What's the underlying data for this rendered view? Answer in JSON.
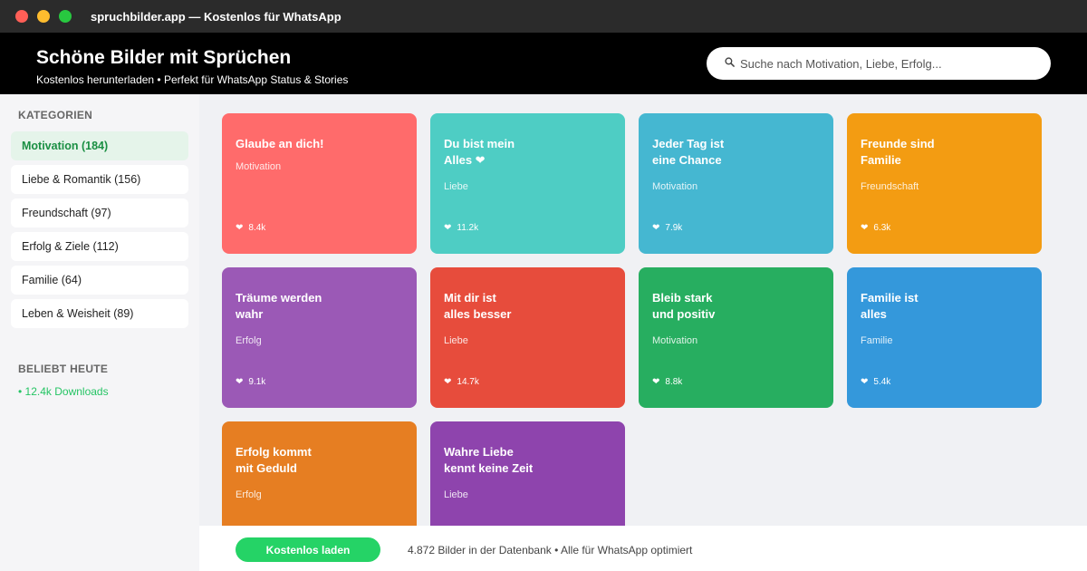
{
  "window": {
    "title": "spruchbilder.app — Kostenlos für WhatsApp"
  },
  "header": {
    "title": "Schöne Bilder mit Sprüchen",
    "subtitle": "Kostenlos herunterladen • Perfekt für WhatsApp Status & Stories",
    "search_placeholder": "Suche nach Motivation, Liebe, Erfolg..."
  },
  "sidebar": {
    "categories_heading": "KATEGORIEN",
    "categories": [
      {
        "label": "Motivation (184)",
        "active": true
      },
      {
        "label": "Liebe & Romantik (156)",
        "active": false
      },
      {
        "label": "Freundschaft (97)",
        "active": false
      },
      {
        "label": "Erfolg & Ziele (112)",
        "active": false
      },
      {
        "label": "Familie (64)",
        "active": false
      },
      {
        "label": "Leben & Weisheit (89)",
        "active": false
      }
    ],
    "popular_heading": "BELIEBT HEUTE",
    "popular_stat": "• 12.4k Downloads"
  },
  "cards": [
    {
      "title": "Glaube an dich!",
      "category": "Motivation",
      "likes": "8.4k",
      "color": "#ff6b6b"
    },
    {
      "title": "Du bist mein\nAlles ❤",
      "category": "Liebe",
      "likes": "11.2k",
      "color": "#4ecdc4"
    },
    {
      "title": "Jeder Tag ist\neine Chance",
      "category": "Motivation",
      "likes": "7.9k",
      "color": "#45b7d1"
    },
    {
      "title": "Freunde sind\nFamilie",
      "category": "Freundschaft",
      "likes": "6.3k",
      "color": "#f39c12"
    },
    {
      "title": "Träume werden\nwahr",
      "category": "Erfolg",
      "likes": "9.1k",
      "color": "#9b59b6"
    },
    {
      "title": "Mit dir ist\nalles besser",
      "category": "Liebe",
      "likes": "14.7k",
      "color": "#e74c3c"
    },
    {
      "title": "Bleib stark\nund positiv",
      "category": "Motivation",
      "likes": "8.8k",
      "color": "#27ae60"
    },
    {
      "title": "Familie ist\nalles",
      "category": "Familie",
      "likes": "5.4k",
      "color": "#3498db"
    },
    {
      "title": "Erfolg kommt\nmit Geduld",
      "category": "Erfolg",
      "likes": "",
      "color": "#e67e22"
    },
    {
      "title": "Wahre Liebe\nkennt keine Zeit",
      "category": "Liebe",
      "likes": "",
      "color": "#8e44ad"
    }
  ],
  "footer": {
    "cta_label": "Kostenlos laden",
    "info": "4.872 Bilder in der Datenbank • Alle für WhatsApp optimiert"
  },
  "colors": {
    "accent_green": "#25d366",
    "header_bg": "#000000",
    "titlebar_bg": "#2b2b2b"
  }
}
